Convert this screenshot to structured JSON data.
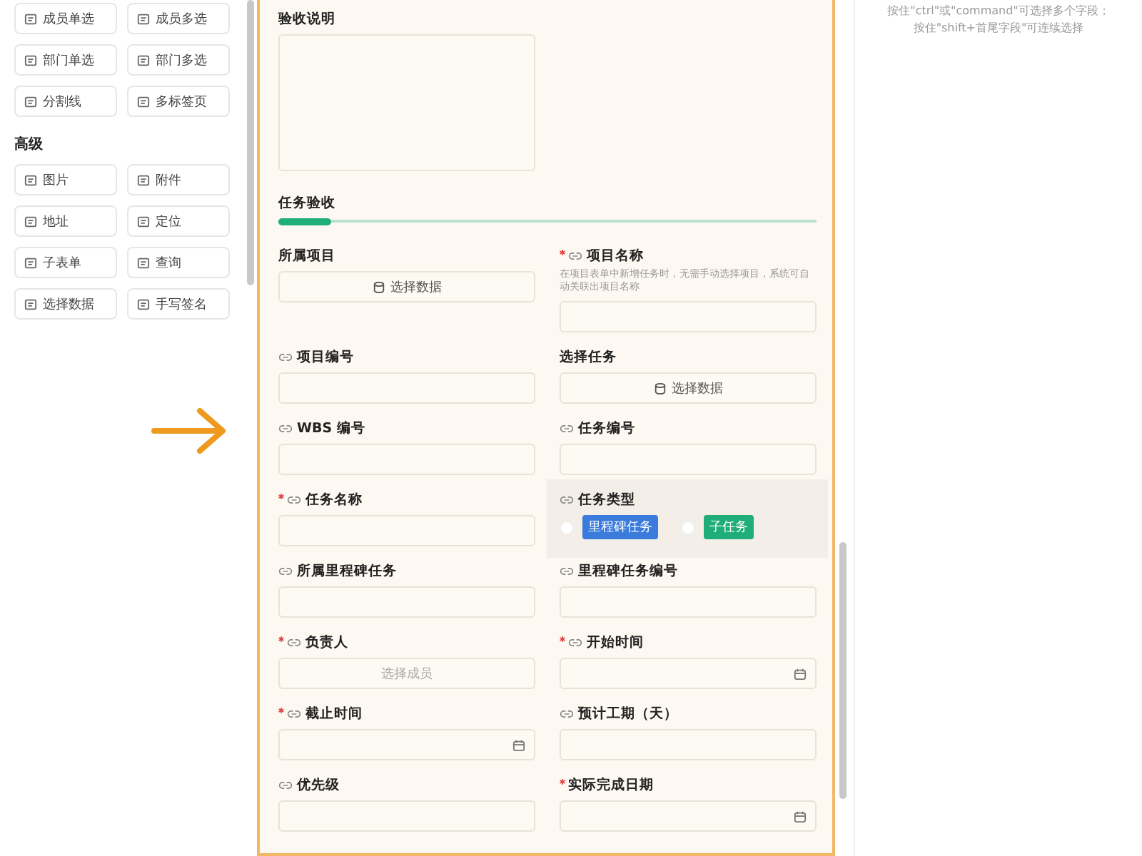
{
  "sidebar": {
    "groups": [
      {
        "items": [
          "成员单选",
          "成员多选",
          "部门单选",
          "部门多选",
          "分割线",
          "多标签页"
        ]
      },
      {
        "heading": "高级",
        "items": [
          "图片",
          "附件",
          "地址",
          "定位",
          "子表单",
          "查询",
          "选择数据",
          "手写签名"
        ]
      }
    ]
  },
  "form": {
    "description_field": {
      "label": "验收说明"
    },
    "section": {
      "title": "任务验收"
    },
    "fields": [
      {
        "label": "所属项目",
        "required": false,
        "linked": false,
        "kind": "select-data",
        "button": "选择数据"
      },
      {
        "label": "项目名称",
        "required": true,
        "linked": true,
        "kind": "input",
        "hint": "在项目表单中新增任务时，无需手动选择项目，系统可自动关联出项目名称"
      },
      {
        "label": "项目编号",
        "required": false,
        "linked": true,
        "kind": "input"
      },
      {
        "label": "选择任务",
        "required": false,
        "linked": false,
        "kind": "select-data",
        "button": "选择数据"
      },
      {
        "label": "WBS 编号",
        "required": false,
        "linked": true,
        "kind": "input"
      },
      {
        "label": "任务编号",
        "required": false,
        "linked": true,
        "kind": "input"
      },
      {
        "label": "任务名称",
        "required": true,
        "linked": true,
        "kind": "input"
      },
      {
        "label": "任务类型",
        "required": false,
        "linked": true,
        "kind": "radio",
        "selected": true,
        "options": [
          {
            "label": "里程碑任务",
            "color": "#3a7bdc",
            "selected": false
          },
          {
            "label": "子任务",
            "color": "#1fae7a",
            "selected": false
          }
        ]
      },
      {
        "label": "所属里程碑任务",
        "required": false,
        "linked": true,
        "kind": "input"
      },
      {
        "label": "里程碑任务编号",
        "required": false,
        "linked": true,
        "kind": "input"
      },
      {
        "label": "负责人",
        "required": true,
        "linked": true,
        "kind": "member",
        "placeholder": "选择成员"
      },
      {
        "label": "开始时间",
        "required": true,
        "linked": true,
        "kind": "date"
      },
      {
        "label": "截止时间",
        "required": true,
        "linked": true,
        "kind": "date"
      },
      {
        "label": "预计工期（天）",
        "required": false,
        "linked": true,
        "kind": "input"
      },
      {
        "label": "优先级",
        "required": false,
        "linked": true,
        "kind": "input"
      },
      {
        "label": "实际完成日期",
        "required": true,
        "linked": false,
        "kind": "date"
      }
    ]
  },
  "tips": [
    "按住\"ctrl\"或\"command\"可选择多个字段；",
    "按住\"shift+首尾字段\"可连续选择"
  ]
}
